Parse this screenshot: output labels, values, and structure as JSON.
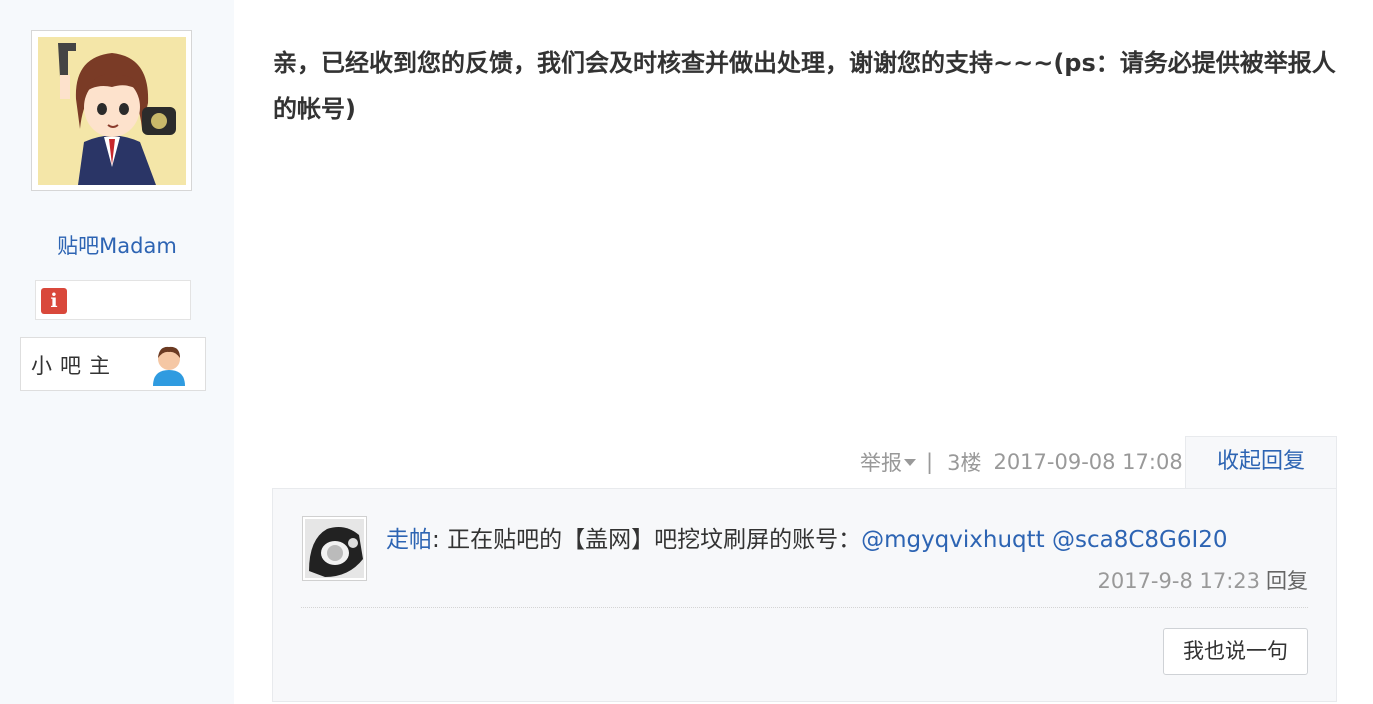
{
  "author": {
    "name": "贴吧Madam",
    "badge_icon": "info-badge-icon",
    "role_label": "小吧主",
    "role_icon": "user-avatar-icon"
  },
  "post": {
    "content": "亲，已经收到您的反馈，我们会及时核查并做出处理，谢谢您的支持~~~(ps：请务必提供被举报人的帐号)"
  },
  "tail": {
    "report_label": "举报",
    "separator": "|",
    "floor": "3楼",
    "time": "2017-09-08 17:08",
    "collapse_label": "收起回复"
  },
  "replies": [
    {
      "user": "走帕",
      "colon": ":",
      "text": "正在贴吧的【盖网】吧挖坟刷屏的账号：",
      "mention1": "@mgyqvixhuqtt",
      "mention2": "@sca8C8G6I20",
      "time": "2017-9-8 17:23",
      "reply_label": "回复"
    }
  ],
  "lzl": {
    "say_button": "我也说一句"
  },
  "colors": {
    "link": "#2d64b3",
    "sidebar_bg": "#f6f9fc",
    "lzl_bg": "#f7f8fa",
    "badge_red": "#d9483b",
    "meta_gray": "#999999"
  }
}
